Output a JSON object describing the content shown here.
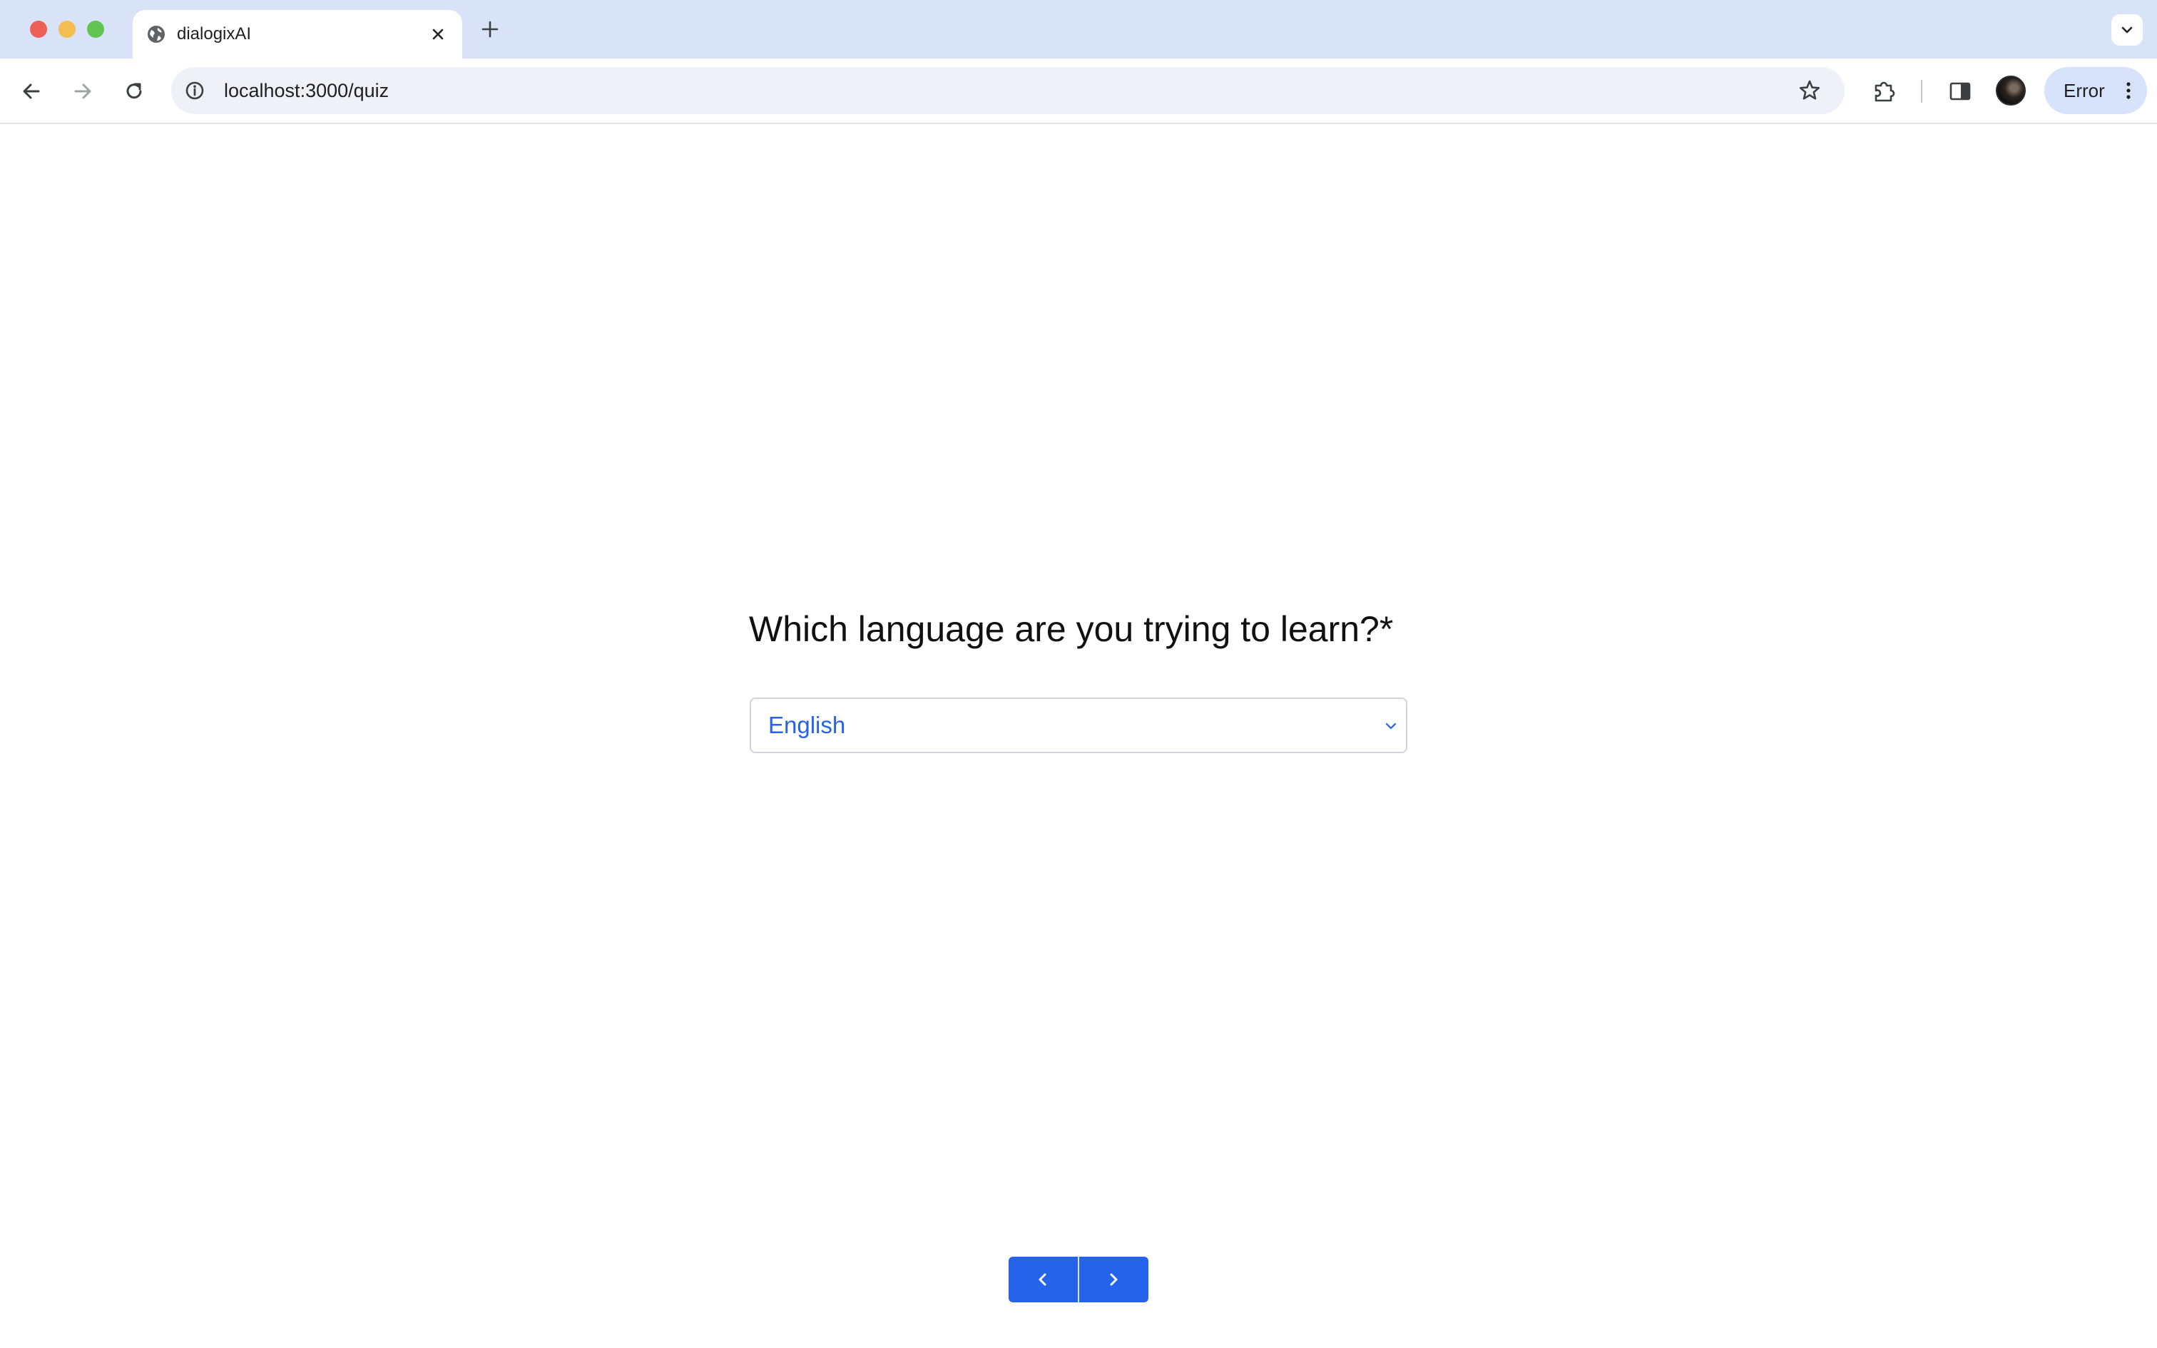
{
  "browser": {
    "tab": {
      "title": "dialogixAI",
      "favicon": "globe-icon",
      "close_icon": "close-icon"
    },
    "new_tab_icon": "plus-icon",
    "tab_search_icon": "chevron-down-icon",
    "nav": {
      "back_icon": "arrow-left-icon",
      "forward_icon": "arrow-right-icon",
      "reload_icon": "reload-icon"
    },
    "omnibox": {
      "info_icon": "info-icon",
      "url": "localhost:3000/quiz",
      "bookmark_icon": "star-icon"
    },
    "extensions_icon": "puzzle-icon",
    "side_panel_icon": "side-panel-icon",
    "profile_icon": "avatar",
    "error_button": {
      "label": "Error",
      "menu_icon": "kebab-menu-icon"
    }
  },
  "quiz": {
    "question": "Which language are you trying to learn?*",
    "select": {
      "selected_value": "English",
      "chevron_icon": "chevron-down-icon"
    },
    "pager": {
      "prev_icon": "chevron-left-icon",
      "next_icon": "chevron-right-icon"
    }
  },
  "colors": {
    "tabstrip_bg": "#d9e3f7",
    "accent_blue": "#2563eb",
    "select_text": "#2563eb",
    "error_button_bg": "#d7e3fb",
    "traffic_red": "#ee5f57",
    "traffic_yellow": "#f4bd4f",
    "traffic_green": "#61c554"
  }
}
